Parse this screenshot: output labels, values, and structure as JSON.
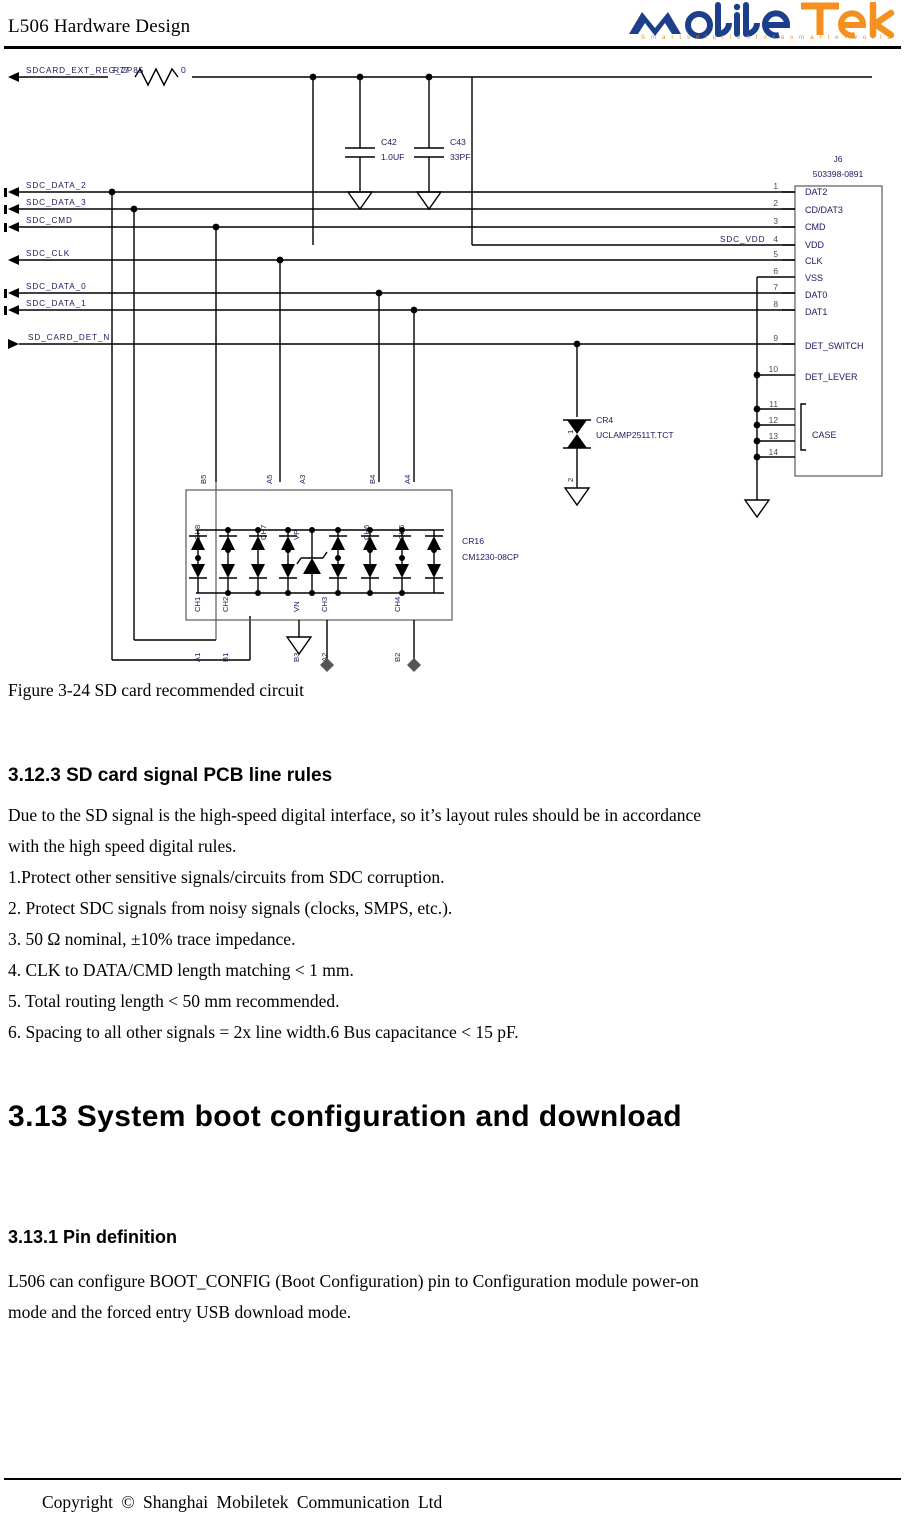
{
  "header": {
    "title": "L506 Hardware Design",
    "brand_name": "MobileTek",
    "brand_tagline": "S m a r t   s o l u t i o n   f o r   a   s m a r t e r   w o r l d",
    "brand_color_blue": "#1b3f8b",
    "brand_color_orange": "#f5901f"
  },
  "schematic": {
    "nets": [
      {
        "name": "SDCARD_EXT_REG_2P85"
      },
      {
        "name": "SDC_DATA_2"
      },
      {
        "name": "SDC_DATA_3"
      },
      {
        "name": "SDC_CMD"
      },
      {
        "name": "SDC_CLK"
      },
      {
        "name": "SDC_DATA_0"
      },
      {
        "name": "SDC_DATA_1"
      },
      {
        "name": "SD_CARD_DET_N"
      },
      {
        "name": "SDC_VDD"
      }
    ],
    "resistor": {
      "refdes": "R77",
      "value": "0"
    },
    "capacitors": [
      {
        "refdes": "C42",
        "value": "1.0UF"
      },
      {
        "refdes": "C43",
        "value": "33PF"
      }
    ],
    "tvs_diode": {
      "refdes": "CR4",
      "part": "UCLAMP2511T.TCT",
      "pin_top": "1",
      "pin_bottom": "2"
    },
    "diode_array": {
      "refdes": "CR16",
      "part": "CM1230-08CP",
      "top_channel_labels": [
        "CH8",
        "CH7",
        "VP",
        "CH6",
        "CH5"
      ],
      "top_pad_labels": [
        "B5",
        "A5",
        "A3",
        "B4",
        "A4"
      ],
      "bottom_channel_labels": [
        "CH1",
        "CH2",
        "VN",
        "CH3",
        "CH4"
      ],
      "bottom_pad_labels": [
        "A1",
        "B1",
        "B3",
        "A2",
        "B2"
      ]
    },
    "connector": {
      "refdes": "J6",
      "part": "503398-0891",
      "pins": [
        {
          "num": "1",
          "name": "DAT2"
        },
        {
          "num": "2",
          "name": "CD/DAT3"
        },
        {
          "num": "3",
          "name": "CMD"
        },
        {
          "num": "4",
          "name": "VDD"
        },
        {
          "num": "5",
          "name": "CLK"
        },
        {
          "num": "6",
          "name": "VSS"
        },
        {
          "num": "7",
          "name": "DAT0"
        },
        {
          "num": "8",
          "name": "DAT1"
        },
        {
          "num": "9",
          "name": "DET_SWITCH"
        },
        {
          "num": "10",
          "name": "DET_LEVER"
        },
        {
          "num": "11",
          "name": ""
        },
        {
          "num": "12",
          "name": "CASE"
        },
        {
          "num": "13",
          "name": ""
        },
        {
          "num": "14",
          "name": ""
        }
      ],
      "case_label": "CASE"
    }
  },
  "body": {
    "figure_caption": "Figure 3-24 SD card recommended circuit",
    "section_3_12_3_heading": "3.12.3 SD card signal PCB line rules",
    "intro_line_1": "Due to the SD signal is the high-speed digital interface, so it’s layout rules should be in accordance",
    "intro_line_2": "with the high speed digital rules.",
    "rules": [
      "1.Protect other sensitive signals/circuits from SDC corruption.",
      "2. Protect SDC signals from noisy signals (clocks, SMPS, etc.).",
      "3. 50 Ω nominal, ±10% trace impedance.",
      "4. CLK to DATA/CMD length matching < 1 mm.",
      "5. Total routing length < 50 mm recommended.",
      "6. Spacing to all other signals = 2x line width.6 Bus capacitance < 15 pF."
    ],
    "section_3_13_heading": "3.13 System boot configuration and download",
    "section_3_13_1_heading": "3.13.1 Pin definition",
    "pin_def_line_1": "L506 can configure BOOT_CONFIG (Boot Configuration) pin to Configuration module power-on",
    "pin_def_line_2": "mode and the forced entry USB download mode."
  },
  "footer": {
    "copyright": "Copyright  ©  Shanghai  Mobiletek  Communication  Ltd"
  }
}
